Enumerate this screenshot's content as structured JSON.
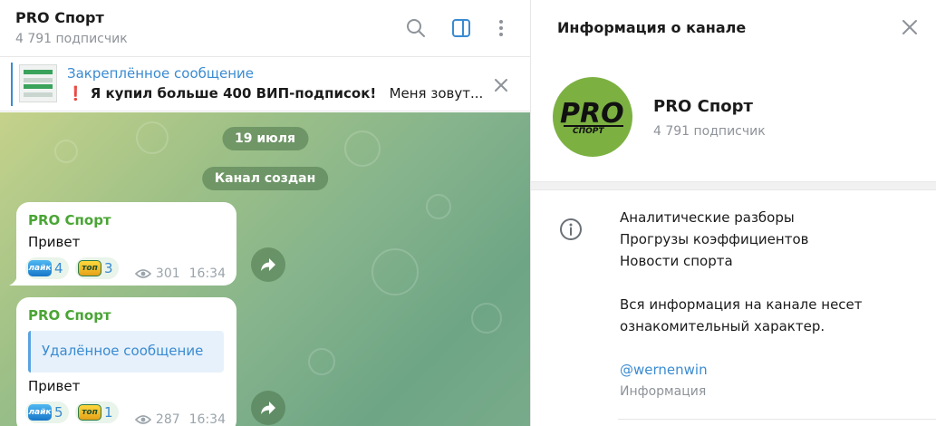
{
  "chat": {
    "title": "PRO Спорт",
    "subtitle": "4 791 подписчик"
  },
  "header_icons": [
    "search-icon",
    "sidebar-toggle-icon",
    "more-vertical-icon"
  ],
  "pinned": {
    "title": "Закреплённое сообщение",
    "emoji": "❗",
    "text_bold": "Я купил больше 400 ВИП-подписок!",
    "text_rest": "Меня зовут..."
  },
  "service_messages": {
    "date": "19 июля",
    "created": "Канал создан"
  },
  "messages": [
    {
      "author": "PRO Спорт",
      "text": "Привет",
      "reactions": [
        {
          "sticker": "лайк",
          "count": "4"
        },
        {
          "sticker": "топ",
          "count": "3"
        }
      ],
      "views": "301",
      "time": "16:34"
    },
    {
      "author": "PRO Спорт",
      "quote": "Удалённое сообщение",
      "text": "Привет",
      "reactions": [
        {
          "sticker": "лайк",
          "count": "5"
        },
        {
          "sticker": "топ",
          "count": "1"
        }
      ],
      "views": "287",
      "time": "16:34"
    }
  ],
  "info": {
    "title": "Информация о канале",
    "name": "PRO Спорт",
    "subtitle": "4 791 подписчик",
    "avatar_logo": "PRO",
    "avatar_logo_sub": "СПОРТ",
    "description_lines": [
      "Аналитические разборы",
      "Прогрузы коэффициентов",
      "Новости спорта",
      "",
      "Вся информация на канале несет",
      "ознакомительный характер."
    ],
    "link": "@wernenwin",
    "description_label": "Информация"
  },
  "colors": {
    "accent": "#3a8bd1",
    "author_green": "#4aa535",
    "avatar_green": "#7cb142",
    "pinned_alert": "#e0182d"
  }
}
